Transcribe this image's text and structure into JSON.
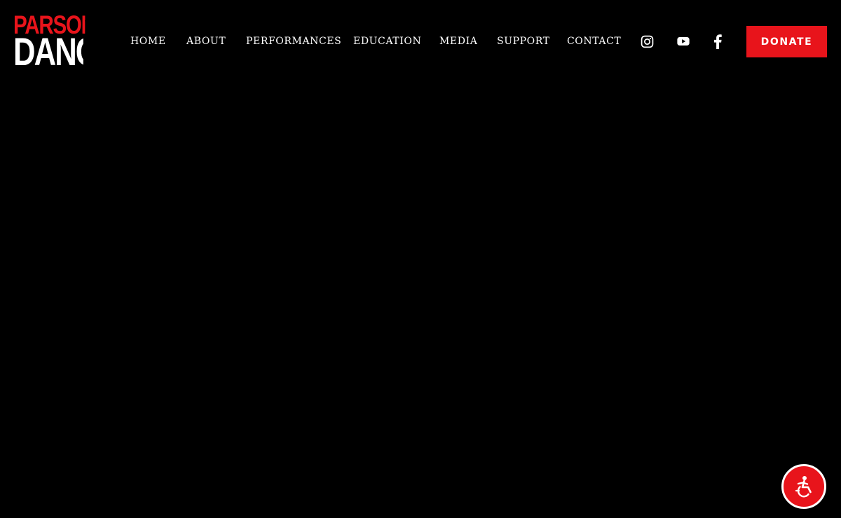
{
  "brand": {
    "logo_line1": "PARSONS",
    "logo_line2": "DANCE"
  },
  "nav": {
    "items": [
      {
        "label": "HOME"
      },
      {
        "label": "ABOUT"
      },
      {
        "label": "PERFORMANCES"
      },
      {
        "label": "EDUCATION"
      },
      {
        "label": "MEDIA"
      },
      {
        "label": "SUPPORT"
      },
      {
        "label": "CONTACT"
      }
    ]
  },
  "social": {
    "icons": [
      "instagram-icon",
      "youtube-icon",
      "facebook-icon"
    ]
  },
  "donate": {
    "label": "DONATE"
  },
  "accessibility": {
    "icon": "accessibility-icon"
  },
  "colors": {
    "background": "#000000",
    "accent_red": "#e8141b",
    "text_white": "#ffffff"
  }
}
